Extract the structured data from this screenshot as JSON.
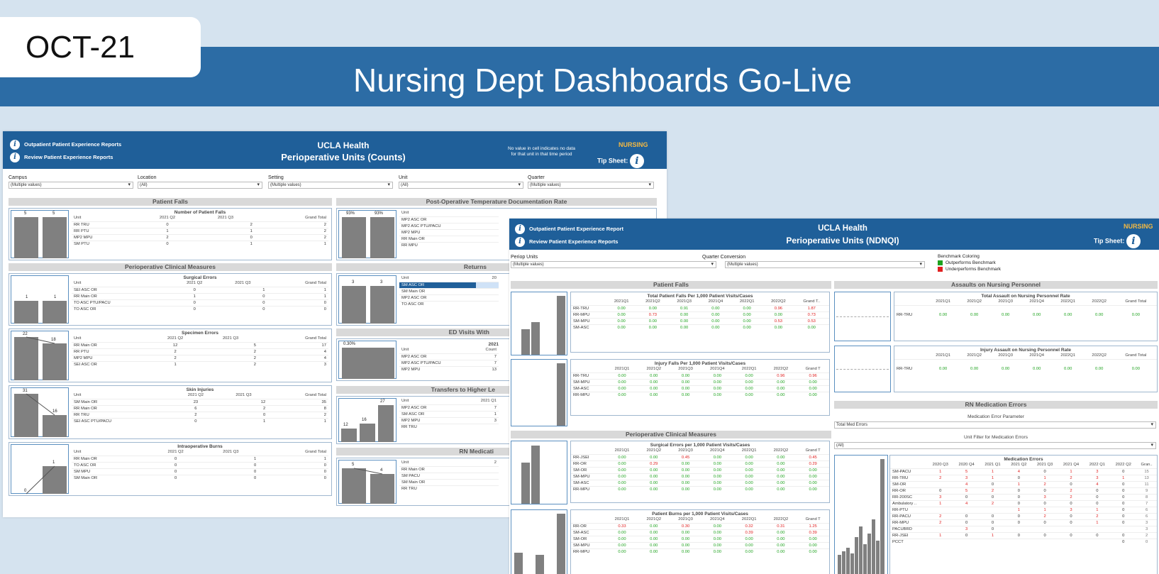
{
  "slide": {
    "date": "OCT-21",
    "title": "Nursing Dept Dashboards Go-Live"
  },
  "colors": {
    "banner": "#2c6ca5",
    "dash_header": "#1f5f99",
    "outperforms": "#1ea21e",
    "underperforms": "#e02020",
    "nursing_logo": "#f4b942"
  },
  "left": {
    "link1": "Outpatient Patient Experience Reports",
    "link2": "Review Patient Experience Reports",
    "title1": "UCLA Health",
    "title2": "Perioperative Units (Counts)",
    "note": [
      "No value in cell indicates no data",
      "for that unit in that time period"
    ],
    "nursing": "NURSING",
    "tip": "Tip Sheet:",
    "filters": [
      {
        "label": "Campus",
        "value": "(Multiple values)"
      },
      {
        "label": "Location",
        "value": "(All)"
      },
      {
        "label": "Setting",
        "value": "(Multiple values)"
      },
      {
        "label": "Unit",
        "value": "(All)"
      },
      {
        "label": "Quarter",
        "value": "(Multiple values)"
      }
    ],
    "sections": {
      "falls": "Patient Falls",
      "clinical": "Perioperative Clinical Measures",
      "temp": "Post-Operative Temperature Documentation Rate",
      "returns": "Returns",
      "ed": "ED Visits With",
      "transfers": "Transfers to Higher Le",
      "rnmed": "RN Medicati"
    },
    "falls": {
      "title": "Number of Patient Falls",
      "bar_labels": [
        "5",
        "5"
      ],
      "headers": [
        "Unit",
        "2021 Q2",
        "2021 Q3",
        "Grand Total"
      ],
      "rows": [
        [
          "RR TRU",
          "0",
          "2",
          "2"
        ],
        [
          "RR PTU",
          "1",
          "1",
          "2"
        ],
        [
          "MP2 MPU",
          "2",
          "0",
          "2"
        ],
        [
          "SM PTU",
          "0",
          "1",
          "1"
        ]
      ]
    },
    "surgical": {
      "title": "Surgical Errors",
      "bar_labels": [
        "1",
        "1"
      ],
      "headers": [
        "Unit",
        "2021 Q2",
        "2021 Q3",
        "Grand Total"
      ],
      "rows": [
        [
          "SEI ASC OR",
          "0",
          "1",
          "1"
        ],
        [
          "RR Main OR",
          "1",
          "0",
          "1"
        ],
        [
          "TO ASC PTU/PACU",
          "0",
          "0",
          "0"
        ],
        [
          "TO ASC OR",
          "0",
          "0",
          "0"
        ]
      ]
    },
    "specimen": {
      "title": "Specimen Errors",
      "bar_labels": [
        "22",
        "18"
      ],
      "headers": [
        "Unit",
        "2021 Q2",
        "2021 Q3",
        "Grand Total"
      ],
      "rows": [
        [
          "RR Main OR",
          "12",
          "5",
          "17"
        ],
        [
          "RR PTU",
          "2",
          "2",
          "4"
        ],
        [
          "MP2 MPU",
          "2",
          "2",
          "4"
        ],
        [
          "SEI ASC OR",
          "1",
          "2",
          "3"
        ]
      ]
    },
    "skin": {
      "title": "Skin Injuries",
      "bar_labels": [
        "31",
        "16"
      ],
      "headers": [
        "Unit",
        "2021 Q2",
        "2021 Q3",
        "Grand Total"
      ],
      "rows": [
        [
          "SM Main OR",
          "23",
          "12",
          "35"
        ],
        [
          "RR Main OR",
          "6",
          "2",
          "8"
        ],
        [
          "RR TRU",
          "2",
          "0",
          "2"
        ],
        [
          "SEI ASC PTU/PACU",
          "0",
          "1",
          "1"
        ]
      ]
    },
    "burns": {
      "title": "Intraoperative Burns",
      "bar_labels": [
        "0",
        "1"
      ],
      "headers": [
        "Unit",
        "2021 Q2",
        "2021 Q3",
        "Grand Total"
      ],
      "rows": [
        [
          "RR Main OR",
          "0",
          "1",
          "1"
        ],
        [
          "TO ASC OR",
          "0",
          "0",
          "0"
        ],
        [
          "SM MPU",
          "0",
          "0",
          "0"
        ],
        [
          "SM Main OR",
          "0",
          "0",
          "0"
        ]
      ]
    },
    "temp": {
      "bar_labels": [
        "93%",
        "93%"
      ],
      "header": "Unit",
      "rows": [
        "MP2 ASC OR",
        "MP2 ASC PTU/PACU",
        "MP2 MPU",
        "RR Main OR",
        "RR MPU"
      ]
    },
    "returns": {
      "bar_labels": [
        "3",
        "3"
      ],
      "header": "Unit",
      "col": "20",
      "rows": [
        "SM ASC OR",
        "SM Main OR",
        "MP2 ASC OR",
        "TO ASC OR"
      ]
    },
    "ed": {
      "bar_label": "0.30%",
      "header_year": "2021",
      "headers": [
        "Unit",
        "Count"
      ],
      "rows": [
        [
          "MP2 ASC OR",
          "7"
        ],
        [
          "MP2 ASC PTU/PACU",
          "7"
        ],
        [
          "MP2 MPU",
          "13"
        ]
      ]
    },
    "transfers": {
      "bar_labels": [
        "12",
        "16",
        "27"
      ],
      "headers": [
        "Unit",
        "2021 Q1"
      ],
      "rows": [
        [
          "MP2 ASC OR",
          "7"
        ],
        [
          "SM ASC OR",
          "1"
        ],
        [
          "MP2 MPU",
          "3"
        ],
        [
          "RR TRU",
          ""
        ]
      ]
    },
    "rnmed": {
      "bar_labels": [
        "5",
        "4"
      ],
      "headers": [
        "Unit",
        "2"
      ],
      "rows": [
        "RR Main OR",
        "SM PACU",
        "SM Main OR",
        "RR TRU"
      ]
    }
  },
  "right": {
    "link1": "Outpatient Patient Experience Report",
    "link2": "Review Patient Experience Reports",
    "title1": "UCLA Health",
    "title2": "Perioperative Units (NDNQI)",
    "nursing": "NURSING",
    "tip": "Tip Sheet:",
    "filters": [
      {
        "label": "Periop Units",
        "value": "(Multiple values)"
      },
      {
        "label": "Quarter Conversion",
        "value": "(Multiple values)"
      }
    ],
    "benchmark": {
      "title": "Benchmark Coloring",
      "out": "Outperforms Benchmark",
      "under": "Underperforms Benchmark"
    },
    "sections": {
      "falls": "Patient Falls",
      "clinical": "Perioperative Clinical Measures",
      "assaults": "Assaults on Nursing Personnel",
      "rnmed": "RN Medication Errors"
    },
    "quarters": [
      "2021Q1",
      "2021Q2",
      "2021Q3",
      "2021Q4",
      "2022Q1",
      "2022Q2"
    ],
    "total_falls": {
      "title": "Total Patient Falls Per 1,000 Patient Visits/Cases",
      "grand": "Grand T..",
      "rows": [
        {
          "unit": "RR-TRU",
          "vals": [
            "0.00",
            "0.00",
            "0.91",
            "0.00",
            "0.00",
            "0.96",
            "1.87"
          ],
          "flags": "gggggrr"
        },
        {
          "unit": "RR-MPU",
          "vals": [
            "0.00",
            "0.73",
            "0.00",
            "0.00",
            "0.00",
            "0.00",
            "0.73"
          ],
          "flags": "grggggr"
        },
        {
          "unit": "SM-MPU",
          "vals": [
            "0.00",
            "0.00",
            "0.00",
            "0.00",
            "0.00",
            "0.53",
            "0.53"
          ],
          "flags": "gggggrr"
        },
        {
          "unit": "SM-ASC",
          "vals": [
            "0.00",
            "0.00",
            "0.00",
            "0.00",
            "0.00",
            "0.00",
            "0.00"
          ],
          "flags": "ggggggg"
        }
      ]
    },
    "injury_falls": {
      "title": "Injury Falls Per 1,000 Patient Visits/Cases",
      "grand": "Grand T",
      "rows": [
        {
          "unit": "RR-TRU",
          "vals": [
            "0.00",
            "0.00",
            "0.00",
            "0.00",
            "0.00",
            "0.96",
            "0.96"
          ],
          "flags": "gggggrr"
        },
        {
          "unit": "SM-MPU",
          "vals": [
            "0.00",
            "0.00",
            "0.00",
            "0.00",
            "0.00",
            "0.00",
            "0.00"
          ],
          "flags": "ggggggg"
        },
        {
          "unit": "SM-ASC",
          "vals": [
            "0.00",
            "0.00",
            "0.00",
            "0.00",
            "0.00",
            "0.00",
            "0.00"
          ],
          "flags": "ggggggg"
        },
        {
          "unit": "RR-MPU",
          "vals": [
            "0.00",
            "0.00",
            "0.00",
            "0.00",
            "0.00",
            "0.00",
            "0.00"
          ],
          "flags": "ggggggg"
        }
      ]
    },
    "surgical": {
      "title": "Surgical Errors per 1,000 Patient Visits/Cases",
      "grand": "Grand T",
      "rows": [
        {
          "unit": "RR-JSEI",
          "vals": [
            "0.00",
            "0.00",
            "0.45",
            "0.00",
            "0.00",
            "0.00",
            "0.45"
          ],
          "flags": "ggrgggr"
        },
        {
          "unit": "RR-OR",
          "vals": [
            "0.00",
            "0.29",
            "0.00",
            "0.00",
            "0.00",
            "0.00",
            "0.29"
          ],
          "flags": "grggggr"
        },
        {
          "unit": "SM-OR",
          "vals": [
            "0.00",
            "0.00",
            "0.00",
            "0.00",
            "0.00",
            "0.00",
            "0.00"
          ],
          "flags": "ggggggg"
        },
        {
          "unit": "SM-MPU",
          "vals": [
            "0.00",
            "0.00",
            "0.00",
            "0.00",
            "0.00",
            "0.00",
            "0.00"
          ],
          "flags": "ggggggg"
        },
        {
          "unit": "SM-ASC",
          "vals": [
            "0.00",
            "0.00",
            "0.00",
            "0.00",
            "0.00",
            "0.00",
            "0.00"
          ],
          "flags": "ggggggg"
        },
        {
          "unit": "RR-MPU",
          "vals": [
            "0.00",
            "0.00",
            "0.00",
            "0.00",
            "0.00",
            "0.00",
            "0.00"
          ],
          "flags": "ggggggg"
        }
      ]
    },
    "burns": {
      "title": "Patient Burns per 1,000 Patient Visits/Cases",
      "grand": "Grand T",
      "rows": [
        {
          "unit": "RR-OR",
          "vals": [
            "0.33",
            "0.00",
            "0.30",
            "0.00",
            "0.32",
            "0.31",
            "1.25"
          ],
          "flags": "rgrgrrr"
        },
        {
          "unit": "SM-ASC",
          "vals": [
            "0.00",
            "0.00",
            "0.00",
            "0.00",
            "0.39",
            "0.00",
            "0.39"
          ],
          "flags": "ggggrgr"
        },
        {
          "unit": "SM-OR",
          "vals": [
            "0.00",
            "0.00",
            "0.00",
            "0.00",
            "0.00",
            "0.00",
            "0.00"
          ],
          "flags": "ggggggg"
        },
        {
          "unit": "SM-MPU",
          "vals": [
            "0.00",
            "0.00",
            "0.00",
            "0.00",
            "0.00",
            "0.00",
            "0.00"
          ],
          "flags": "ggggggg"
        },
        {
          "unit": "RR-MPU",
          "vals": [
            "0.00",
            "0.00",
            "0.00",
            "0.00",
            "0.00",
            "0.00",
            "0.00"
          ],
          "flags": "ggggggg"
        }
      ]
    },
    "total_assault": {
      "title": "Total Assault on Nursing Personnel Rate",
      "grand": "Grand Total",
      "unit": "RR-TRU",
      "vals": [
        "0.00",
        "0.00",
        "0.00",
        "0.00",
        "0.00",
        "0.00",
        "0.00"
      ]
    },
    "injury_assault": {
      "title": "Injury Assault on Nursing Personnel Rate",
      "grand": "Grand Total",
      "unit": "RR-TRU",
      "vals": [
        "0.00",
        "0.00",
        "0.00",
        "0.00",
        "0.00",
        "0.00",
        "0.00"
      ]
    },
    "med_param": {
      "title": "Medication Error Parameter",
      "value": "Total Med Errors"
    },
    "unit_filter": {
      "title": "Unit Filter for Medication Errors",
      "value": "(All)"
    },
    "med_errors": {
      "title": "Medication Errors",
      "headers": [
        "2020 Q3",
        "2020 Q4",
        "2021 Q1",
        "2021 Q2",
        "2021 Q3",
        "2021 Q4",
        "2022 Q1",
        "2022 Q2",
        "Gran.."
      ],
      "rows": [
        {
          "unit": "SM-PACU",
          "vals": [
            "1",
            "5",
            "1",
            "4",
            "0",
            "1",
            "3",
            "0",
            "15"
          ]
        },
        {
          "unit": "RR-TRU",
          "vals": [
            "2",
            "3",
            "1",
            "0",
            "1",
            "2",
            "3",
            "1",
            "13"
          ]
        },
        {
          "unit": "SM-OR",
          "vals": [
            "",
            "4",
            "0",
            "1",
            "2",
            "0",
            "4",
            "0",
            "11"
          ]
        },
        {
          "unit": "RR-OR",
          "vals": [
            "0",
            "5",
            "2",
            "0",
            "0",
            "2",
            "0",
            "0",
            "9"
          ]
        },
        {
          "unit": "RR-200SC",
          "vals": [
            "3",
            "0",
            "0",
            "0",
            "3",
            "2",
            "0",
            "0",
            "8"
          ]
        },
        {
          "unit": "Ambulatory ..",
          "vals": [
            "1",
            "4",
            "2",
            "0",
            "0",
            "0",
            "0",
            "0",
            "7"
          ]
        },
        {
          "unit": "RR-PTU",
          "vals": [
            "",
            "",
            "",
            "1",
            "1",
            "3",
            "1",
            "0",
            "6"
          ]
        },
        {
          "unit": "RR-PACU",
          "vals": [
            "2",
            "0",
            "0",
            "0",
            "2",
            "0",
            "2",
            "0",
            "6"
          ]
        },
        {
          "unit": "RR-MPU",
          "vals": [
            "2",
            "0",
            "0",
            "0",
            "0",
            "0",
            "1",
            "0",
            "3"
          ]
        },
        {
          "unit": "PACUBRD",
          "vals": [
            "",
            "3",
            "0",
            "",
            "",
            "",
            "",
            "",
            "3"
          ]
        },
        {
          "unit": "RR-JSEI",
          "vals": [
            "1",
            "0",
            "1",
            "0",
            "0",
            "0",
            "0",
            "0",
            "2"
          ]
        },
        {
          "unit": "PCCT",
          "vals": [
            "",
            "",
            "",
            "",
            "",
            "",
            "",
            "0",
            "0"
          ]
        }
      ]
    }
  }
}
